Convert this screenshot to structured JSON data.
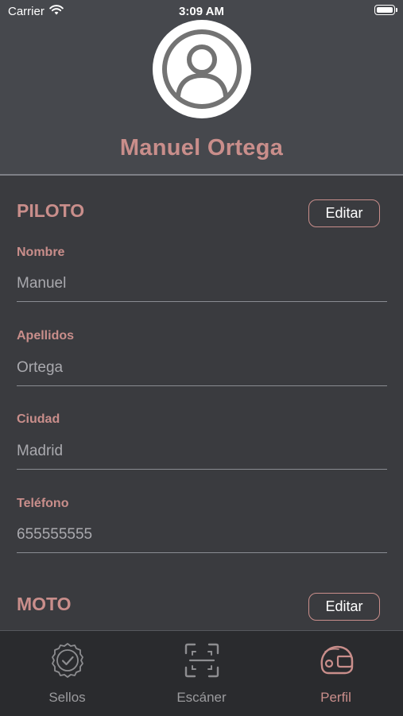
{
  "status_bar": {
    "carrier": "Carrier",
    "time": "3:09 AM",
    "wifi_icon": "wifi-icon",
    "battery_icon": "battery-icon"
  },
  "profile": {
    "avatar_icon": "user-avatar-icon",
    "name": "Manuel Ortega"
  },
  "piloto": {
    "title": "PILOTO",
    "edit_label": "Editar",
    "fields": [
      {
        "label": "Nombre",
        "value": "Manuel"
      },
      {
        "label": "Apellidos",
        "value": "Ortega"
      },
      {
        "label": "Ciudad",
        "value": "Madrid"
      },
      {
        "label": "Teléfono",
        "value": "655555555"
      }
    ]
  },
  "moto": {
    "title": "MOTO",
    "edit_label": "Editar"
  },
  "tab_bar": {
    "tabs": [
      {
        "label": "Sellos",
        "icon": "seal-badge-icon",
        "active": false
      },
      {
        "label": "Escáner",
        "icon": "scanner-icon",
        "active": false
      },
      {
        "label": "Perfil",
        "icon": "helmet-icon",
        "active": true
      }
    ]
  },
  "colors": {
    "accent": "#c98e8b",
    "header_bg": "#46484d",
    "content_bg": "#3a3b3f",
    "tab_bar_bg": "#2a2b2e",
    "value_text": "#a9a9ae",
    "inactive_tab": "#9b9b9e"
  }
}
